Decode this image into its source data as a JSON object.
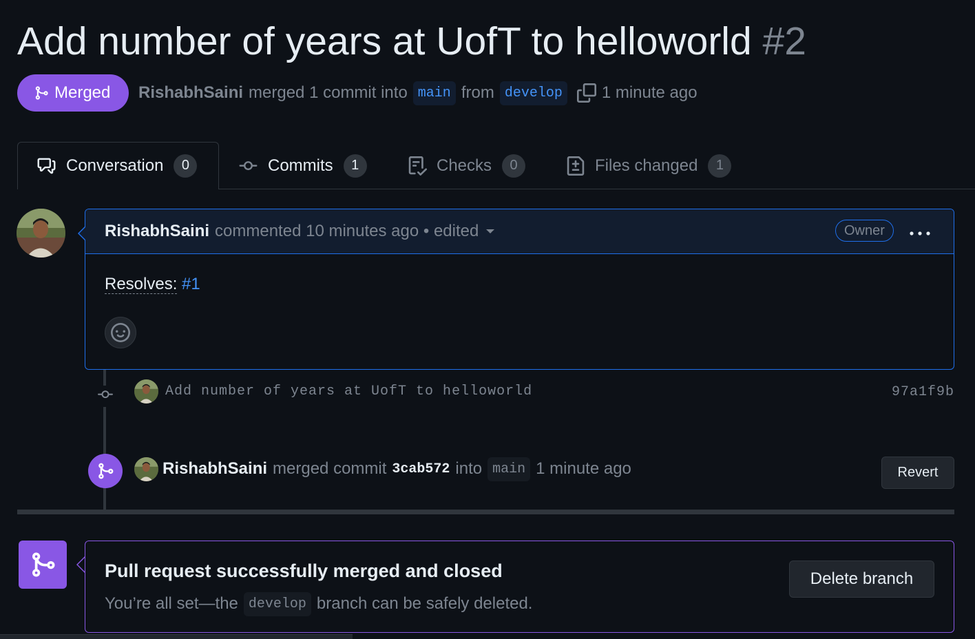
{
  "pr": {
    "title": "Add number of years at UofT to helloworld",
    "number": "#2",
    "state": "Merged",
    "author": "RishabhSaini",
    "merged_text": "merged 1 commit into",
    "base_branch": "main",
    "from_text": "from",
    "head_branch": "develop",
    "time": "1 minute ago"
  },
  "tabs": [
    {
      "label": "Conversation",
      "count": "0",
      "icon": "comment-discussion-icon"
    },
    {
      "label": "Commits",
      "count": "1",
      "icon": "git-commit-icon"
    },
    {
      "label": "Checks",
      "count": "0",
      "icon": "checklist-icon"
    },
    {
      "label": "Files changed",
      "count": "1",
      "icon": "file-diff-icon"
    }
  ],
  "comment": {
    "author": "RishabhSaini",
    "meta": "commented 10 minutes ago • edited",
    "role": "Owner",
    "body_prefix": "Resolves:",
    "issue_link": "#1"
  },
  "commit": {
    "message": "Add number of years at UofT to helloworld",
    "sha": "97a1f9b"
  },
  "merge_event": {
    "author": "RishabhSaini",
    "text1": "merged commit",
    "sha": "3cab572",
    "text2": "into",
    "branch": "main",
    "time": "1 minute ago",
    "revert_label": "Revert"
  },
  "merge_status": {
    "title": "Pull request successfully merged and closed",
    "sub_prefix": "You’re all set—the",
    "branch": "develop",
    "sub_suffix": "branch can be safely deleted.",
    "delete_label": "Delete branch"
  },
  "colors": {
    "background": "#0d1117",
    "merged_purple": "#8957e5",
    "accent_blue": "#1f6feb",
    "link_blue": "#4493f8"
  }
}
